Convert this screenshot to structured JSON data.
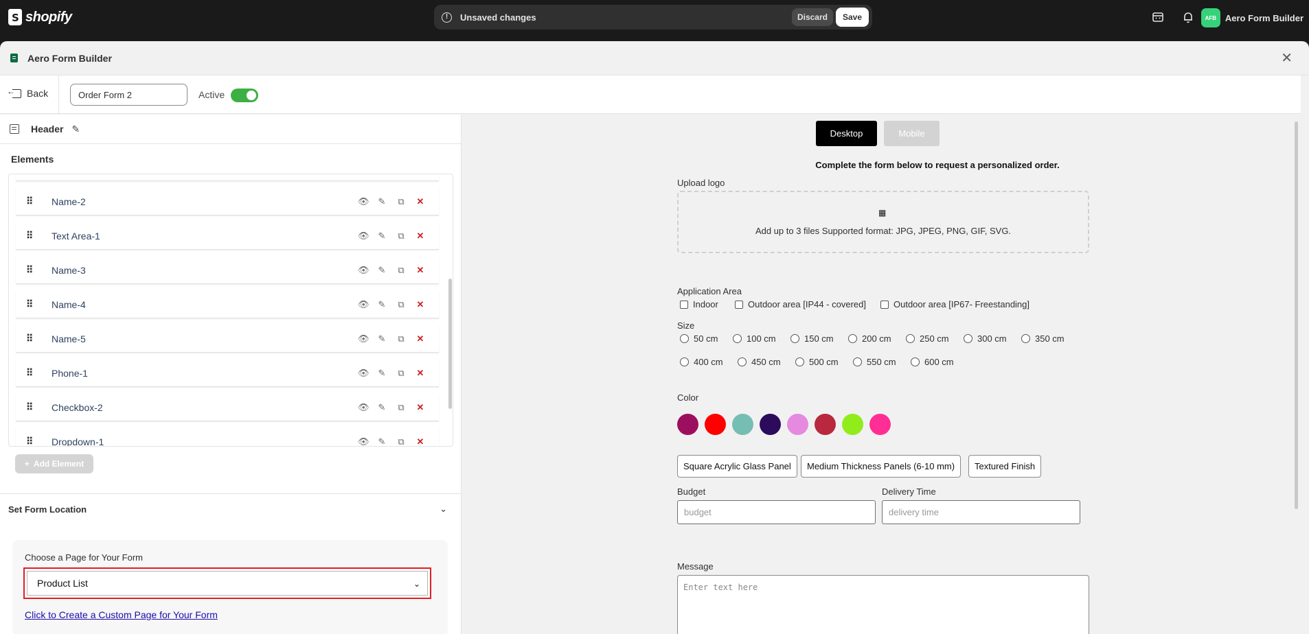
{
  "topbar": {
    "logo_text": "shopify",
    "unsaved_text": "Unsaved changes",
    "discard_label": "Discard",
    "save_label": "Save",
    "avatar_initials": "AFB",
    "account_name": "Aero Form Builder"
  },
  "window": {
    "title": "Aero Form Builder"
  },
  "toolbar": {
    "back_label": "Back",
    "form_name": "Order Form 2",
    "active_label": "Active",
    "active": true
  },
  "left": {
    "header_label": "Header",
    "elements_title": "Elements",
    "elements": [
      "Name-2",
      "Text Area-1",
      "Name-3",
      "Name-4",
      "Name-5",
      "Phone-1",
      "Checkbox-2",
      "Dropdown-1"
    ],
    "add_element_label": "Add Element",
    "location_label": "Set Form Location",
    "page_label": "Choose a Page for Your Form",
    "page_value": "Product List",
    "custom_page_link": "Click to Create a Custom Page for Your Form"
  },
  "preview": {
    "tab_desktop": "Desktop",
    "tab_mobile": "Mobile",
    "heading": "Complete the form below to request a personalized order.",
    "upload_label": "Upload logo",
    "upload_text": "Add up to 3 files Supported format: JPG, JPEG, PNG, GIF, SVG.",
    "area_label": "Application Area",
    "area_options": [
      "Indoor",
      "Outdoor area [IP44 - covered]",
      "Outdoor area [IP67- Freestanding]"
    ],
    "size_label": "Size",
    "size_options": [
      "50 cm",
      "100 cm",
      "150 cm",
      "200 cm",
      "250 cm",
      "300 cm",
      "350 cm",
      "400 cm",
      "450 cm",
      "500 cm",
      "550 cm",
      "600 cm"
    ],
    "color_label": "Color",
    "colors": [
      "#9c0f5f",
      "#ff0000",
      "#76bdb3",
      "#2c0a5c",
      "#e58ade",
      "#b8283f",
      "#90ed1b",
      "#ff2e94"
    ],
    "chips": [
      "Square Acrylic Glass Panel",
      "Medium Thickness Panels (6-10 mm)",
      "Textured Finish"
    ],
    "budget_label": "Budget",
    "budget_placeholder": "budget",
    "delivery_label": "Delivery Time",
    "delivery_placeholder": "delivery time",
    "message_label": "Message",
    "message_placeholder": "Enter text here"
  }
}
